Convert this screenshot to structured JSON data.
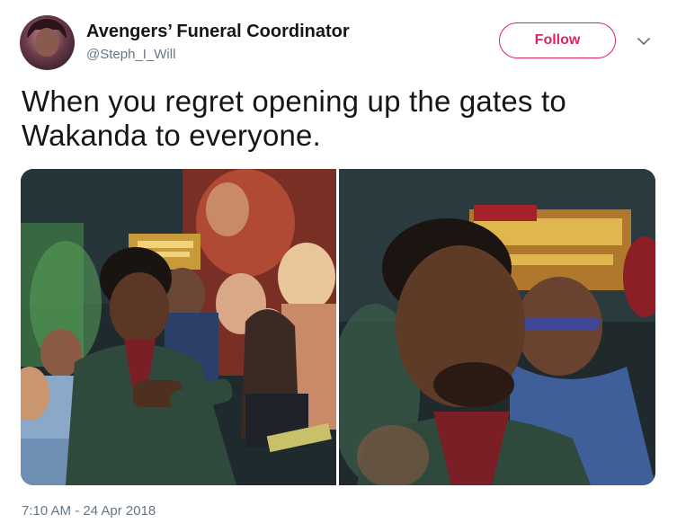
{
  "tweet": {
    "display_name": "Avengers’ Funeral Coordinator",
    "handle": "@Steph_I_Will",
    "follow_label": "Follow",
    "text": "When you regret opening up the gates to Wakanda to everyone.",
    "timestamp": "7:10 AM - 24 Apr 2018"
  },
  "icons": {
    "avatar": "avatar",
    "more": "chevron-down-icon"
  },
  "colors": {
    "accent": "#e0245e",
    "text": "#14171a",
    "secondary_text": "#657786"
  }
}
